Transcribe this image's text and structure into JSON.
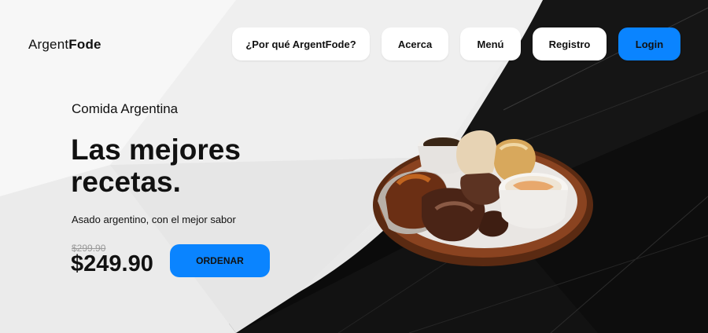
{
  "brand": {
    "name_light": "Argent",
    "name_bold": "Fode"
  },
  "nav": {
    "why": "¿Por qué ArgentFode?",
    "about": "Acerca",
    "menu": "Menú",
    "register": "Registro",
    "login": "Login"
  },
  "hero": {
    "eyebrow": "Comida Argentina",
    "headline": "Las mejores recetas.",
    "subline": "Asado argentino, con el mejor sabor",
    "old_price": "$299.90",
    "price": "$249.90",
    "order_label": "ORDENAR"
  },
  "colors": {
    "accent": "#0a84ff",
    "background_dark": "#0a0a0a",
    "background_light": "#f2f2f2"
  },
  "icons": {
    "dish_image": "asado-plate-image"
  }
}
